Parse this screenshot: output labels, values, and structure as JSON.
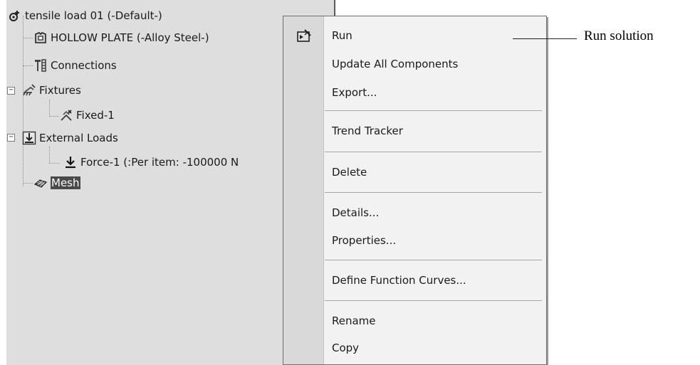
{
  "tree": {
    "root": "tensile load 01 (-Default-)",
    "part": "HOLLOW PLATE (-Alloy Steel-)",
    "connections": "Connections",
    "fixtures": "Fixtures",
    "fixed1": "Fixed-1",
    "external_loads": "External Loads",
    "force1": "Force-1 (:Per item: -100000 N",
    "mesh": "Mesh",
    "expander_symbol": "−"
  },
  "menu": {
    "run": "Run",
    "update_all": "Update All Components",
    "export": "Export...",
    "trend_tracker": "Trend Tracker",
    "delete": "Delete",
    "details": "Details...",
    "properties": "Properties...",
    "define_function_curves": "Define Function Curves...",
    "rename": "Rename",
    "copy": "Copy"
  },
  "callout": {
    "text": "Run solution"
  },
  "icons": {
    "study": "study-icon",
    "part": "part-icon",
    "connections": "connections-icon",
    "fixtures": "fixtures-icon",
    "fixed": "fixed-geometry-icon",
    "external_loads": "external-loads-icon",
    "force": "force-arrow-icon",
    "mesh": "mesh-icon",
    "run": "run-icon"
  }
}
